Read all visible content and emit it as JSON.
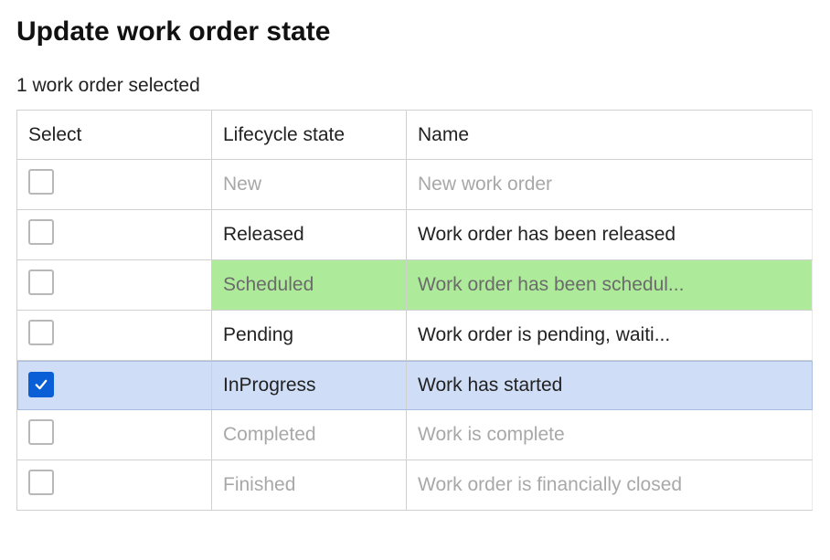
{
  "header": {
    "title": "Update work order state",
    "subtitle": "1 work order selected"
  },
  "table": {
    "columns": {
      "select": "Select",
      "state": "Lifecycle state",
      "name": "Name"
    },
    "rows": [
      {
        "state": "New",
        "name": "New work order",
        "checked": false,
        "disabled": true,
        "highlight": ""
      },
      {
        "state": "Released",
        "name": "Work order has been released",
        "checked": false,
        "disabled": false,
        "highlight": ""
      },
      {
        "state": "Scheduled",
        "name": "Work order has been schedul...",
        "checked": false,
        "disabled": false,
        "highlight": "green"
      },
      {
        "state": "Pending",
        "name": "Work order is pending,  waiti...",
        "checked": false,
        "disabled": false,
        "highlight": ""
      },
      {
        "state": "InProgress",
        "name": "Work has started",
        "checked": true,
        "disabled": false,
        "highlight": "blue"
      },
      {
        "state": "Completed",
        "name": "Work is complete",
        "checked": false,
        "disabled": true,
        "highlight": ""
      },
      {
        "state": "Finished",
        "name": "Work order is financially closed",
        "checked": false,
        "disabled": true,
        "highlight": ""
      }
    ]
  }
}
